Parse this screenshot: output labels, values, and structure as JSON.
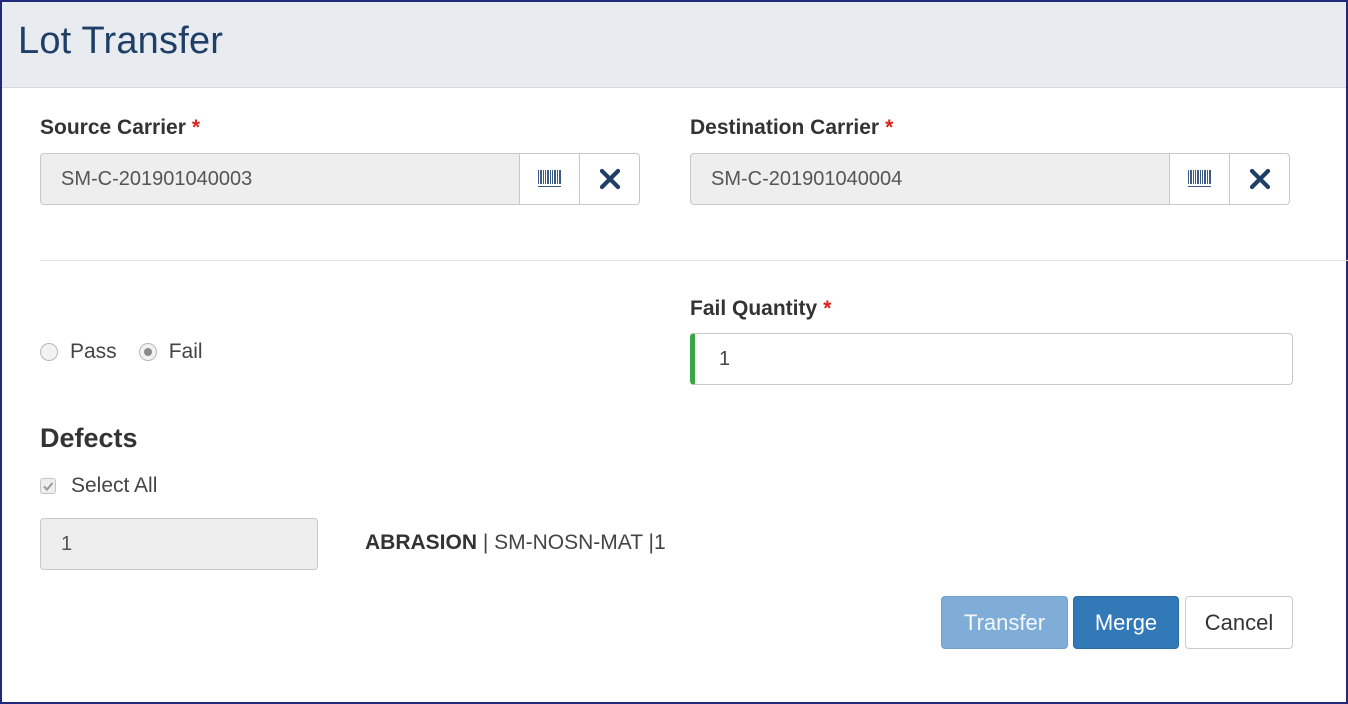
{
  "header": {
    "title": "Lot Transfer"
  },
  "source": {
    "label": "Source Carrier",
    "required_mark": "*",
    "value": "SM-C-201901040003",
    "scan_icon": "barcode-icon",
    "clear_icon": "close-icon"
  },
  "destination": {
    "label": "Destination Carrier",
    "required_mark": "*",
    "value": "SM-C-201901040004",
    "scan_icon": "barcode-icon",
    "clear_icon": "close-icon"
  },
  "result": {
    "options": [
      {
        "label": "Pass",
        "checked": false
      },
      {
        "label": "Fail",
        "checked": true
      }
    ]
  },
  "fail_quantity": {
    "label": "Fail Quantity",
    "required_mark": "*",
    "value": "1"
  },
  "defects": {
    "title": "Defects",
    "select_all_label": "Select All",
    "select_all_checked": true,
    "items": [
      {
        "quantity": "1",
        "code": "ABRASION",
        "detail": " | SM-NOSN-MAT |1"
      }
    ]
  },
  "actions": {
    "transfer": "Transfer",
    "merge": "Merge",
    "cancel": "Cancel"
  },
  "colors": {
    "header_bg": "#e8ecf1",
    "title": "#1f3f66",
    "required": "#d9251c",
    "valid_bar": "#3aa646",
    "primary": "#3279b7",
    "primary_disabled": "#7fadd8"
  }
}
